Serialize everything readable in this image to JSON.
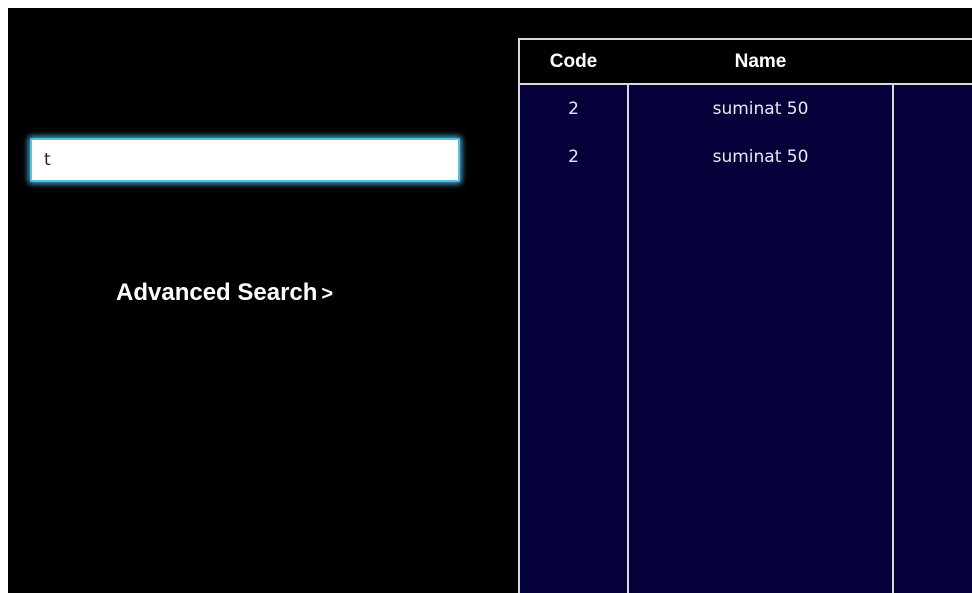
{
  "search": {
    "value": "t"
  },
  "advanced_search": {
    "label": "Advanced Search",
    "chevron": ">"
  },
  "table": {
    "columns": [
      "Code",
      "Name",
      ""
    ],
    "rows": [
      {
        "code": "2",
        "name": "suminat 50"
      },
      {
        "code": "2",
        "name": "suminat 50"
      }
    ]
  },
  "colors": {
    "window_bg": "#000000",
    "grid_bg": "#03003a",
    "grid_line": "#d9d9d9",
    "input_glow": "#4fc3e8"
  }
}
